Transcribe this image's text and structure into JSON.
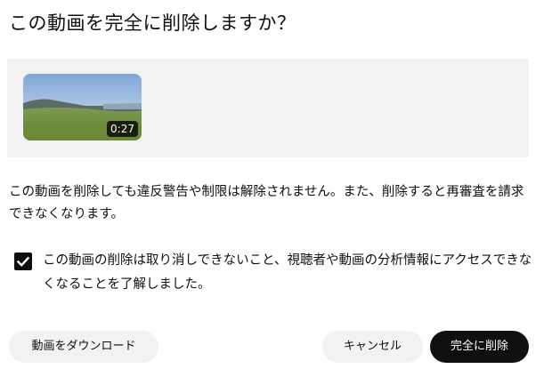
{
  "dialog": {
    "title": "この動画を完全に削除しますか？",
    "video": {
      "duration": "0:27"
    },
    "warning_text": "この動画を削除しても違反警告や制限は解除されません。また、削除すると再審査を請求できなくなります。",
    "confirm_checkbox": {
      "checked": true,
      "label": "この動画の削除は取り消しできないこと、視聴者や動画の分析情報にアクセスできなくなることを了解しました。"
    },
    "buttons": {
      "download": "動画をダウンロード",
      "cancel": "キャンセル",
      "delete": "完全に削除"
    }
  },
  "colors": {
    "primary_button": "#0f0f0f",
    "secondary_button": "#f2f2f2",
    "preview_background": "#f2f2f2"
  },
  "icons": {
    "checkbox": "checkmark-icon"
  }
}
